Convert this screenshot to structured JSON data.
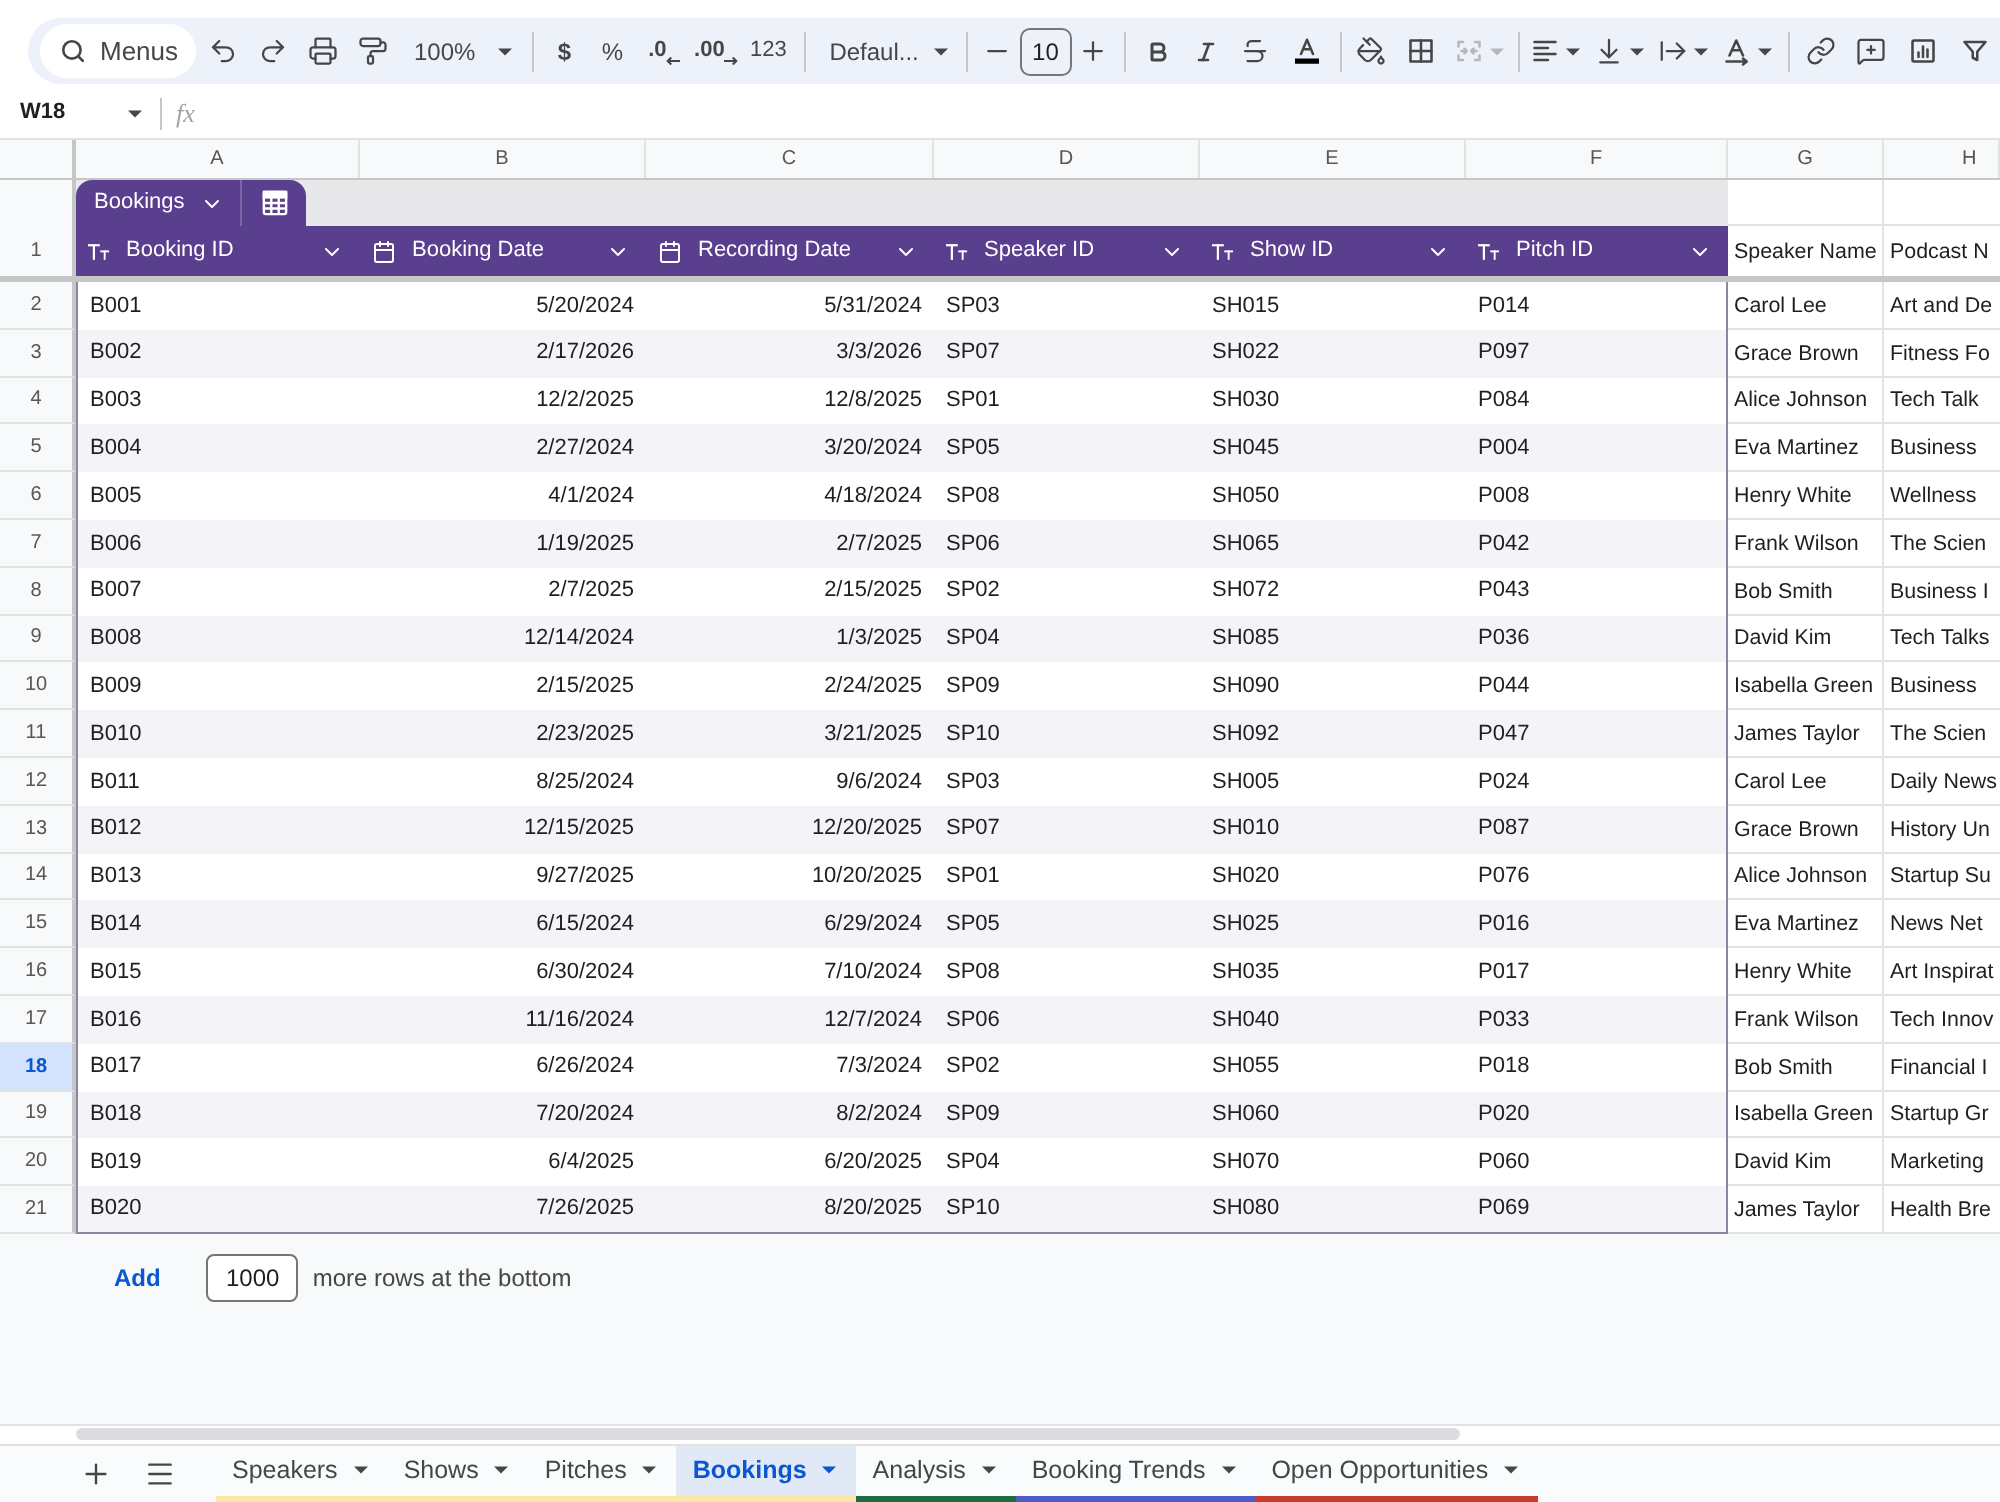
{
  "toolbar": {
    "search": {
      "placeholder": "Menus"
    },
    "zoom": "100%",
    "number_formats": [
      {
        "label": "$",
        "kind": "currency"
      },
      {
        "label": "%",
        "kind": "percent"
      },
      {
        "label": ".0",
        "kind": "decrease_decimals"
      },
      {
        "label": ".00",
        "kind": "increase_decimals"
      },
      {
        "label": "123",
        "kind": "more_formats"
      }
    ],
    "font": "Defaul...",
    "font_size": "10"
  },
  "formula_bar": {
    "cell_reference": "W18",
    "function_label": "fx"
  },
  "column_letters": [
    "A",
    "B",
    "C",
    "D",
    "E",
    "F",
    "G",
    "H"
  ],
  "table": {
    "name": "Bookings",
    "header_row_number": "1",
    "columns": [
      {
        "label": "Booking ID",
        "kind": "text"
      },
      {
        "label": "Booking Date",
        "kind": "date"
      },
      {
        "label": "Recording Date",
        "kind": "date"
      },
      {
        "label": "Speaker ID",
        "kind": "text"
      },
      {
        "label": "Show ID",
        "kind": "text"
      },
      {
        "label": "Pitch ID",
        "kind": "text"
      }
    ],
    "outside_headers": [
      "Speaker Name",
      "Podcast N"
    ],
    "rows": [
      {
        "number": "2",
        "selected": false,
        "cells": [
          "B001",
          "5/20/2024",
          "5/31/2024",
          "SP03",
          "SH015",
          "P014"
        ],
        "outside_cells": [
          "Carol Lee",
          "Art and De"
        ]
      },
      {
        "number": "3",
        "selected": false,
        "cells": [
          "B002",
          "2/17/2026",
          "3/3/2026",
          "SP07",
          "SH022",
          "P097"
        ],
        "outside_cells": [
          "Grace Brown",
          "Fitness Fo"
        ]
      },
      {
        "number": "4",
        "selected": false,
        "cells": [
          "B003",
          "12/2/2025",
          "12/8/2025",
          "SP01",
          "SH030",
          "P084"
        ],
        "outside_cells": [
          "Alice Johnson",
          "Tech Talk"
        ]
      },
      {
        "number": "5",
        "selected": false,
        "cells": [
          "B004",
          "2/27/2024",
          "3/20/2024",
          "SP05",
          "SH045",
          "P004"
        ],
        "outside_cells": [
          "Eva Martinez",
          "Business"
        ]
      },
      {
        "number": "6",
        "selected": false,
        "cells": [
          "B005",
          "4/1/2024",
          "4/18/2024",
          "SP08",
          "SH050",
          "P008"
        ],
        "outside_cells": [
          "Henry White",
          "Wellness"
        ]
      },
      {
        "number": "7",
        "selected": false,
        "cells": [
          "B006",
          "1/19/2025",
          "2/7/2025",
          "SP06",
          "SH065",
          "P042"
        ],
        "outside_cells": [
          "Frank Wilson",
          "The Scien"
        ]
      },
      {
        "number": "8",
        "selected": false,
        "cells": [
          "B007",
          "2/7/2025",
          "2/15/2025",
          "SP02",
          "SH072",
          "P043"
        ],
        "outside_cells": [
          "Bob Smith",
          "Business I"
        ]
      },
      {
        "number": "9",
        "selected": false,
        "cells": [
          "B008",
          "12/14/2024",
          "1/3/2025",
          "SP04",
          "SH085",
          "P036"
        ],
        "outside_cells": [
          "David Kim",
          "Tech Talks"
        ]
      },
      {
        "number": "10",
        "selected": false,
        "cells": [
          "B009",
          "2/15/2025",
          "2/24/2025",
          "SP09",
          "SH090",
          "P044"
        ],
        "outside_cells": [
          "Isabella Green",
          "Business"
        ]
      },
      {
        "number": "11",
        "selected": false,
        "cells": [
          "B010",
          "2/23/2025",
          "3/21/2025",
          "SP10",
          "SH092",
          "P047"
        ],
        "outside_cells": [
          "James Taylor",
          "The Scien"
        ]
      },
      {
        "number": "12",
        "selected": false,
        "cells": [
          "B011",
          "8/25/2024",
          "9/6/2024",
          "SP03",
          "SH005",
          "P024"
        ],
        "outside_cells": [
          "Carol Lee",
          "Daily News"
        ]
      },
      {
        "number": "13",
        "selected": false,
        "cells": [
          "B012",
          "12/15/2025",
          "12/20/2025",
          "SP07",
          "SH010",
          "P087"
        ],
        "outside_cells": [
          "Grace Brown",
          "History Un"
        ]
      },
      {
        "number": "14",
        "selected": false,
        "cells": [
          "B013",
          "9/27/2025",
          "10/20/2025",
          "SP01",
          "SH020",
          "P076"
        ],
        "outside_cells": [
          "Alice Johnson",
          "Startup Su"
        ]
      },
      {
        "number": "15",
        "selected": false,
        "cells": [
          "B014",
          "6/15/2024",
          "6/29/2024",
          "SP05",
          "SH025",
          "P016"
        ],
        "outside_cells": [
          "Eva Martinez",
          "News Net"
        ]
      },
      {
        "number": "16",
        "selected": false,
        "cells": [
          "B015",
          "6/30/2024",
          "7/10/2024",
          "SP08",
          "SH035",
          "P017"
        ],
        "outside_cells": [
          "Henry White",
          "Art Inspirat"
        ]
      },
      {
        "number": "17",
        "selected": false,
        "cells": [
          "B016",
          "11/16/2024",
          "12/7/2024",
          "SP06",
          "SH040",
          "P033"
        ],
        "outside_cells": [
          "Frank Wilson",
          "Tech Innov"
        ]
      },
      {
        "number": "18",
        "selected": true,
        "cells": [
          "B017",
          "6/26/2024",
          "7/3/2024",
          "SP02",
          "SH055",
          "P018"
        ],
        "outside_cells": [
          "Bob Smith",
          "Financial I"
        ]
      },
      {
        "number": "19",
        "selected": false,
        "cells": [
          "B018",
          "7/20/2024",
          "8/2/2024",
          "SP09",
          "SH060",
          "P020"
        ],
        "outside_cells": [
          "Isabella Green",
          "Startup Gr"
        ]
      },
      {
        "number": "20",
        "selected": false,
        "cells": [
          "B019",
          "6/4/2025",
          "6/20/2025",
          "SP04",
          "SH070",
          "P060"
        ],
        "outside_cells": [
          "David Kim",
          "Marketing"
        ]
      },
      {
        "number": "21",
        "selected": false,
        "cells": [
          "B020",
          "7/26/2025",
          "8/20/2025",
          "SP10",
          "SH080",
          "P069"
        ],
        "outside_cells": [
          "James Taylor",
          "Health Bre"
        ]
      }
    ]
  },
  "add_rows": {
    "button": "Add",
    "count": "1000",
    "label": "more rows at the bottom"
  },
  "sheet_tabs": [
    {
      "label": "Speakers",
      "selected": false,
      "color": "#fbe8a6"
    },
    {
      "label": "Shows",
      "selected": false,
      "color": "#fbe8a6"
    },
    {
      "label": "Pitches",
      "selected": false,
      "color": "#fbe8a6"
    },
    {
      "label": "Bookings",
      "selected": true,
      "color": "#fbe8a6"
    },
    {
      "label": "Analysis",
      "selected": false,
      "color": "#1f6e43"
    },
    {
      "label": "Booking Trends",
      "selected": false,
      "color": "#4e5bc4"
    },
    {
      "label": "Open Opportunities",
      "selected": false,
      "color": "#cc3b2f"
    }
  ]
}
